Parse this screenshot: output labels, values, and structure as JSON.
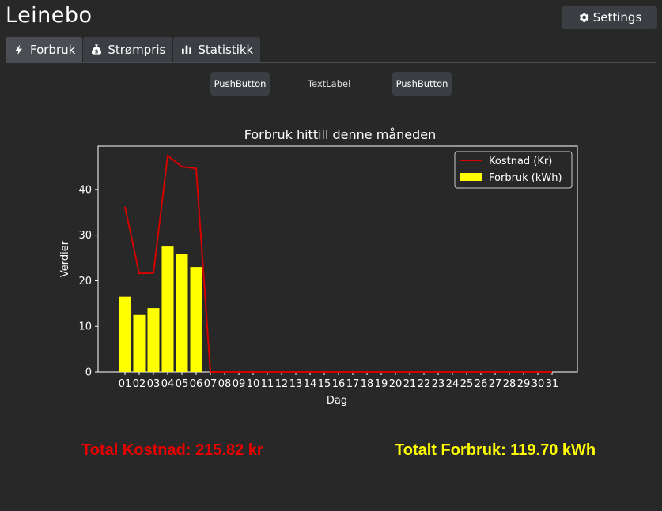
{
  "app": {
    "logo_text": "Leinebo"
  },
  "header": {
    "settings_label": "Settings",
    "settings_icon": "gear-icon"
  },
  "tabs": [
    {
      "label": "Forbruk",
      "icon": "lightning-icon",
      "active": true
    },
    {
      "label": "Strømpris",
      "icon": "money-bag-icon",
      "active": false
    },
    {
      "label": "Statistikk",
      "icon": "bar-chart-icon",
      "active": false
    }
  ],
  "controls": {
    "left_button": "PushButton",
    "text_label": "TextLabel",
    "right_button": "PushButton"
  },
  "chart_data": {
    "type": "bar+line",
    "title": "Forbruk hittill denne måneden",
    "xlabel": "Dag",
    "ylabel": "Verdier",
    "categories": [
      "01",
      "02",
      "03",
      "04",
      "05",
      "06",
      "07",
      "08",
      "09",
      "10",
      "11",
      "12",
      "13",
      "14",
      "15",
      "16",
      "17",
      "18",
      "19",
      "20",
      "21",
      "22",
      "23",
      "24",
      "25",
      "26",
      "27",
      "28",
      "29",
      "30",
      "31"
    ],
    "yticks": [
      0,
      10,
      20,
      30,
      40
    ],
    "ylim": [
      0,
      49.5
    ],
    "legend_position": "top-right",
    "series": [
      {
        "name": "Kostnad (Kr)",
        "type": "line",
        "color": "#d40000",
        "values": [
          36.2,
          21.6,
          21.7,
          47.4,
          45.0,
          44.6,
          0,
          0,
          0,
          0,
          0,
          0,
          0,
          0,
          0,
          0,
          0,
          0,
          0,
          0,
          0,
          0,
          0,
          0,
          0,
          0,
          0,
          0,
          0,
          0,
          0
        ]
      },
      {
        "name": "Forbruk (kWh)",
        "type": "bar",
        "color": "#ffff00",
        "values": [
          16.5,
          12.5,
          14.0,
          27.5,
          25.8,
          23.0,
          0,
          0,
          0,
          0,
          0,
          0,
          0,
          0,
          0,
          0,
          0,
          0,
          0,
          0,
          0,
          0,
          0,
          0,
          0,
          0,
          0,
          0,
          0,
          0,
          0
        ]
      }
    ]
  },
  "totals": {
    "cost_text": "Total Kostnad: 215.82 kr",
    "cost_color": "#e60000",
    "usage_text": "Totalt Forbruk: 119.70 kWh",
    "usage_color": "#ffff00"
  }
}
